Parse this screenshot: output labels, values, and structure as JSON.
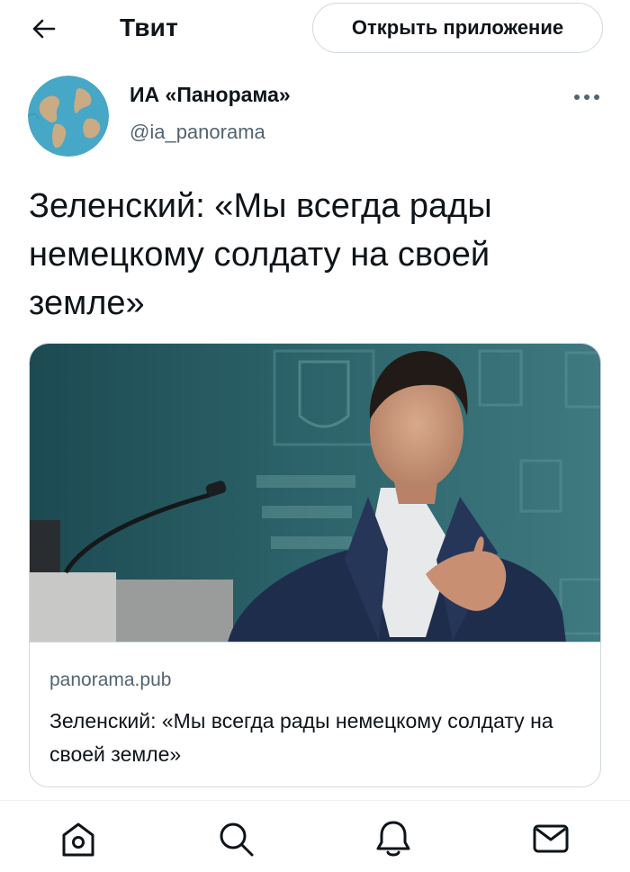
{
  "header": {
    "title": "Твит",
    "open_app_label": "Открыть приложение",
    "back_icon": "arrow-left-icon"
  },
  "author": {
    "name": "ИА «Панорама»",
    "handle": "@ia_panorama",
    "avatar_icon": "globe-avatar"
  },
  "tweet": {
    "text": "Зеленский: «Мы всегда рады немецкому солдату на своей земле»"
  },
  "card": {
    "domain": "panorama.pub",
    "title": "Зеленский: «Мы всегда рады немецкому солдату на своей земле»",
    "image": "photo-speaker-at-podium"
  },
  "bottom_nav": {
    "items": [
      "home-icon",
      "search-icon",
      "notifications-icon",
      "messages-icon"
    ]
  },
  "colors": {
    "text_primary": "#0f1419",
    "text_secondary": "#536471",
    "border": "#cfd9de"
  }
}
